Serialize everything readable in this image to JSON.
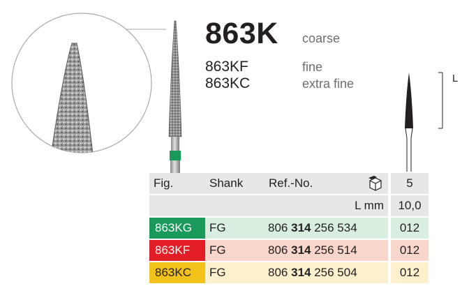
{
  "product": {
    "title": "863K",
    "title_grit": "coarse",
    "variants": [
      {
        "code": "863KF",
        "grit": "fine"
      },
      {
        "code": "863KC",
        "grit": "extra fine"
      }
    ]
  },
  "dimension_label": "L",
  "table": {
    "headers": {
      "fig": "Fig.",
      "shank": "Shank",
      "ref": "Ref.-No.",
      "pack": "5"
    },
    "length_label": "L mm",
    "length_value": "10,0",
    "rows": [
      {
        "fig": "863KG",
        "shank": "FG",
        "ref_prefix": "806",
        "ref_bold": "314",
        "ref_suffix": "256 534",
        "size": "012",
        "band_color": "#1a9a5a",
        "row_color": "#d9eede"
      },
      {
        "fig": "863KF",
        "shank": "FG",
        "ref_prefix": "806",
        "ref_bold": "314",
        "ref_suffix": "256 514",
        "size": "012",
        "band_color": "#e31d25",
        "row_color": "#f8d6cc"
      },
      {
        "fig": "863KC",
        "shank": "FG",
        "ref_prefix": "806",
        "ref_bold": "314",
        "ref_suffix": "256 504",
        "size": "012",
        "band_color": "#f3c21a",
        "row_color": "#fdf0cc"
      }
    ]
  },
  "colors": {
    "header_gray": "#e6e7e8",
    "green_ring": "#1a9a5a"
  }
}
